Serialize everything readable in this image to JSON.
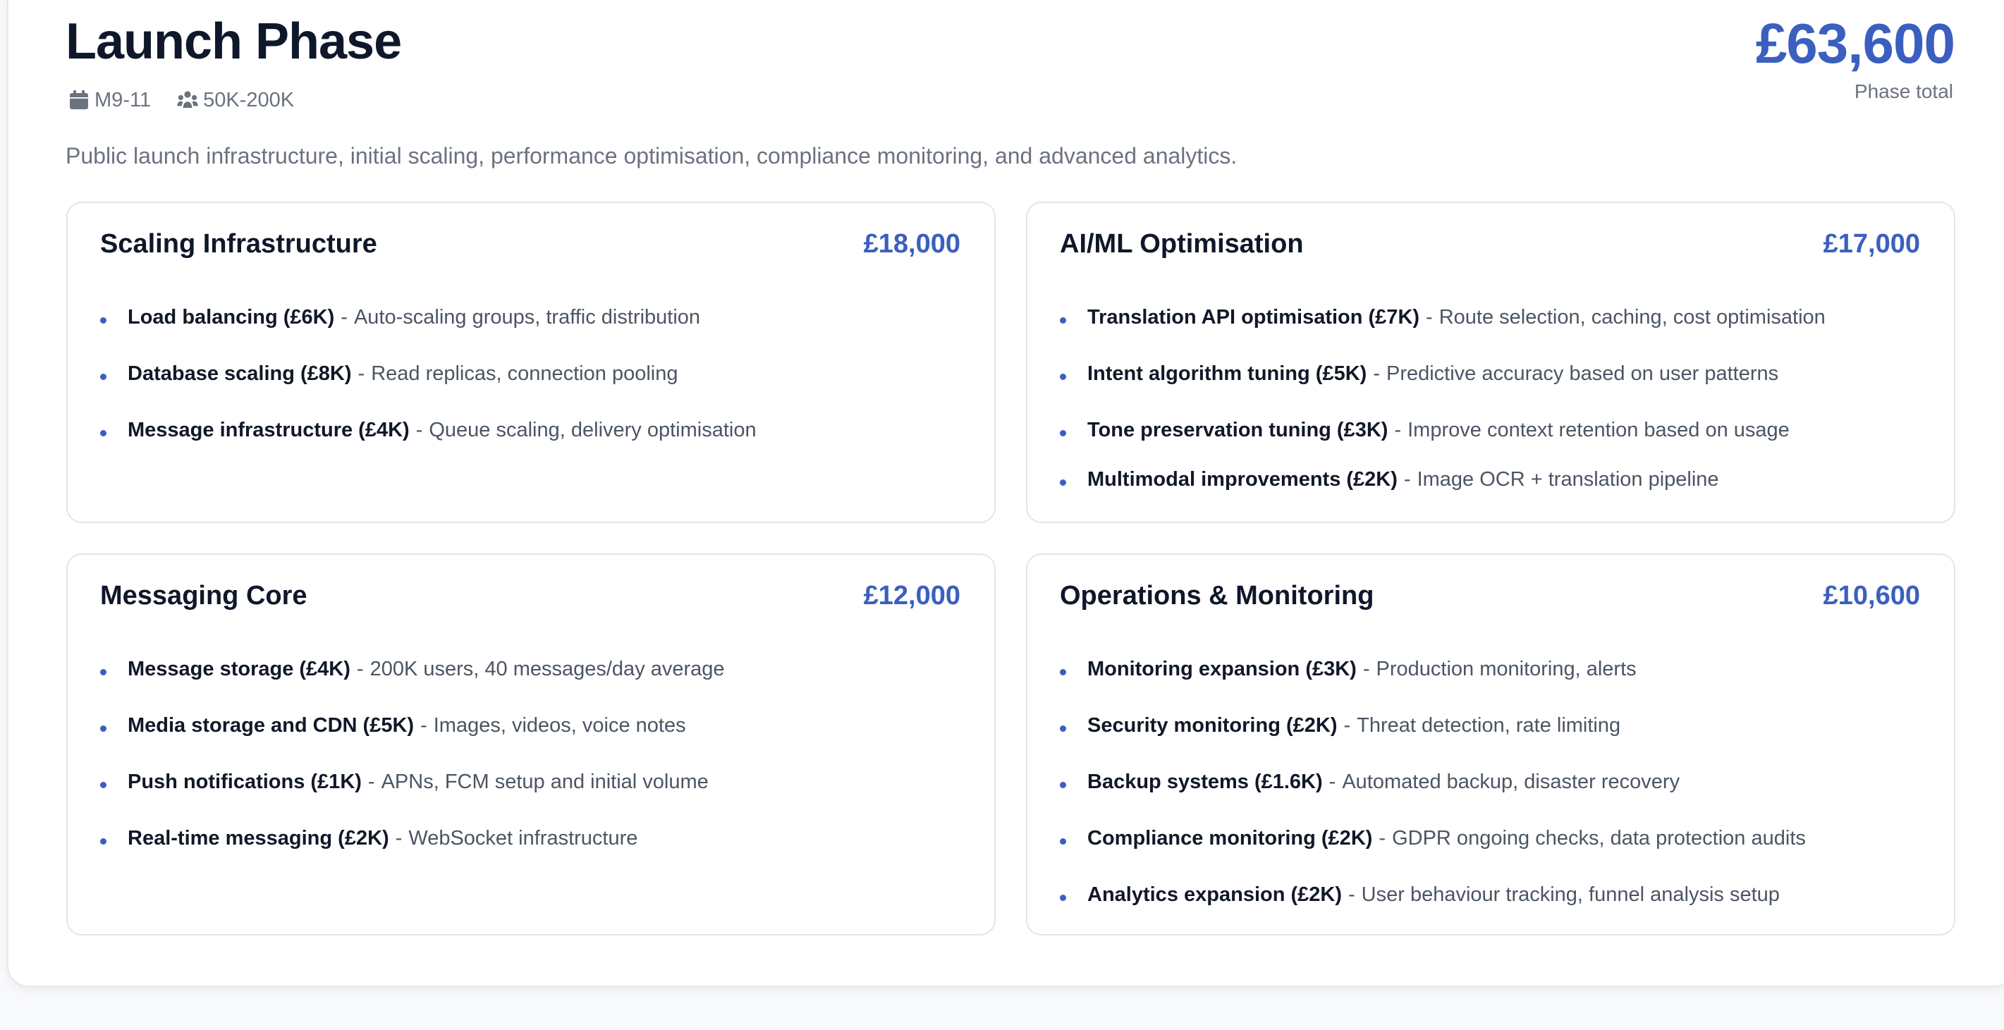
{
  "phase": {
    "title": "Launch Phase",
    "months": "M9-11",
    "users": "50K-200K",
    "total": "£63,600",
    "total_label": "Phase total",
    "description": "Public launch infrastructure, initial scaling, performance optimisation, compliance monitoring, and advanced analytics."
  },
  "icons": {
    "months": "calendar-icon",
    "users": "users-icon"
  },
  "colors": {
    "accent": "#3b5fc0",
    "title": "#0f172a",
    "muted": "#6b7280",
    "border": "#e3e5ea"
  },
  "separator": "-",
  "cards": [
    {
      "title": "Scaling Infrastructure",
      "cost": "£18,000",
      "items": [
        {
          "name": "Load balancing (£6K)",
          "desc": "Auto-scaling groups, traffic distribution"
        },
        {
          "name": "Database scaling (£8K)",
          "desc": "Read replicas, connection pooling"
        },
        {
          "name": "Message infrastructure (£4K)",
          "desc": "Queue scaling, delivery optimisation"
        }
      ]
    },
    {
      "title": "AI/ML Optimisation",
      "cost": "£17,000",
      "items": [
        {
          "name": "Translation API optimisation (£7K)",
          "desc": "Route selection, caching, cost optimisation"
        },
        {
          "name": "Intent algorithm tuning (£5K)",
          "desc": "Predictive accuracy based on user patterns"
        },
        {
          "name": "Tone preservation tuning (£3K)",
          "desc": "Improve context retention based on usage"
        },
        {
          "name": "Multimodal improvements (£2K)",
          "desc": "Image OCR + translation pipeline"
        }
      ]
    },
    {
      "title": "Messaging Core",
      "cost": "£12,000",
      "items": [
        {
          "name": "Message storage (£4K)",
          "desc": "200K users, 40 messages/day average"
        },
        {
          "name": "Media storage and CDN (£5K)",
          "desc": "Images, videos, voice notes"
        },
        {
          "name": "Push notifications (£1K)",
          "desc": "APNs, FCM setup and initial volume"
        },
        {
          "name": "Real-time messaging (£2K)",
          "desc": "WebSocket infrastructure"
        }
      ]
    },
    {
      "title": "Operations & Monitoring",
      "cost": "£10,600",
      "items": [
        {
          "name": "Monitoring expansion (£3K)",
          "desc": "Production monitoring, alerts"
        },
        {
          "name": "Security monitoring (£2K)",
          "desc": "Threat detection, rate limiting"
        },
        {
          "name": "Backup systems (£1.6K)",
          "desc": "Automated backup, disaster recovery"
        },
        {
          "name": "Compliance monitoring (£2K)",
          "desc": "GDPR ongoing checks, data protection audits"
        },
        {
          "name": "Analytics expansion (£2K)",
          "desc": "User behaviour tracking, funnel analysis setup"
        }
      ]
    }
  ]
}
